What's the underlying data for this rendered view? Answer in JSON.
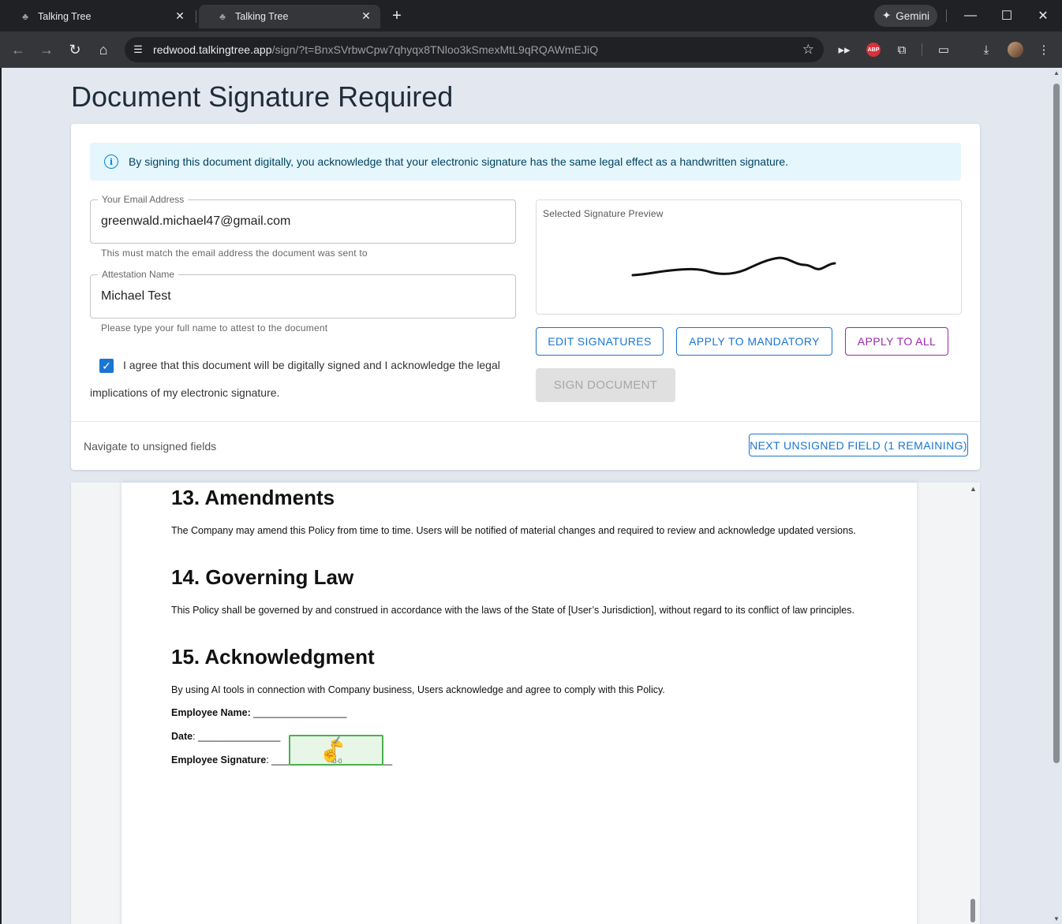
{
  "browser": {
    "tabs": [
      {
        "title": "Talking Tree",
        "active": false
      },
      {
        "title": "Talking Tree",
        "active": true
      }
    ],
    "gemini_label": "Gemini",
    "url_host": "redwood.talkingtree.app",
    "url_path": "/sign/?t=BnxSVrbwCpw7qhyqx8TNloo3kSmexMtL9qRQAWmEJiQ",
    "abp_label": "ABP",
    "icons": [
      "back-icon",
      "forward-icon",
      "reload-icon",
      "home-icon",
      "site-info-icon",
      "star-icon",
      "extension-icon",
      "download-icon",
      "menu-icon"
    ]
  },
  "page": {
    "title": "Document Signature Required",
    "alert_text": "By signing this document digitally, you acknowledge that your electronic signature has the same legal effect as a handwritten signature.",
    "email": {
      "label": "Your Email Address",
      "value": "greenwald.michael47@gmail.com",
      "helper": "This must match the email address the document was sent to"
    },
    "attestation": {
      "label": "Attestation Name",
      "value": "Michael Test",
      "helper": "Please type your full name to attest to the document"
    },
    "agree": {
      "checked": true,
      "line1": "I agree that this document will be digitally signed and I acknowledge the legal",
      "line2": "implications of my electronic signature."
    },
    "preview_label": "Selected Signature Preview",
    "buttons": {
      "edit": "EDIT SIGNATURES",
      "apply_mandatory": "APPLY TO MANDATORY",
      "apply_all": "APPLY TO ALL",
      "sign": "SIGN DOCUMENT",
      "next": "NEXT UNSIGNED FIELD (1 REMAINING)"
    },
    "nav_text": "Navigate to unsigned fields",
    "colors": {
      "primary": "#1976d2",
      "secondary": "#9c27b0",
      "alert_bg": "#e5f6fd",
      "sig_field": "#4caf50"
    }
  },
  "document": {
    "sections": [
      {
        "heading": "13. Amendments",
        "text": "The Company may amend this Policy from time to time. Users will be notified of material changes and required to review and acknowledge updated versions."
      },
      {
        "heading": "14. Governing Law",
        "text": "This Policy shall be governed by and construed in accordance with the laws of the State of [User’s Jurisdiction], without regard to its conflict of law principles."
      },
      {
        "heading": "15. Acknowledgment",
        "text": "By using AI tools in connection with Company business, Users acknowledge and agree to comply with this Policy."
      }
    ],
    "employee_name_label": "Employee Name:",
    "employee_name_line": "_________________",
    "date_label": "Date",
    "date_line": ": _______________",
    "signature_label": "Employee Signature",
    "signature_line": ": ______________________",
    "sig_field_id": "id-0"
  }
}
